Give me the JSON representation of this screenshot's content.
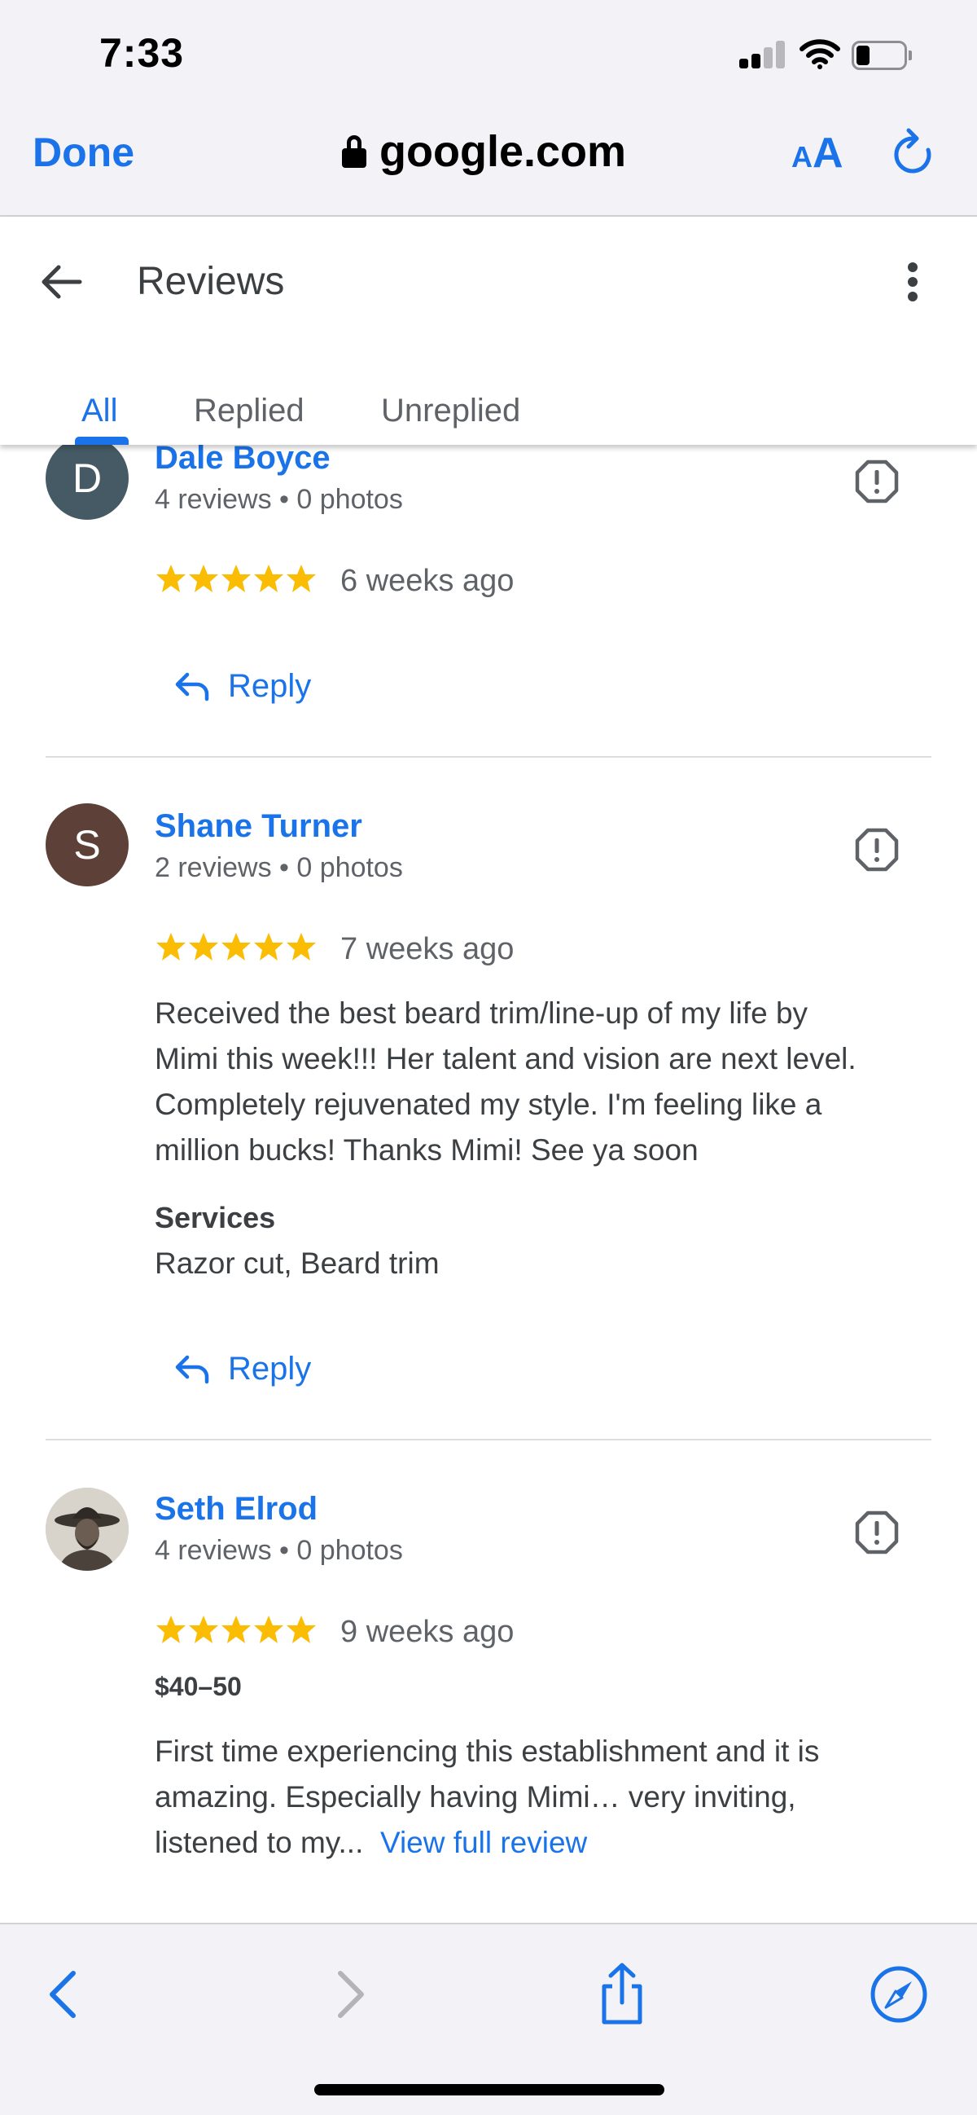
{
  "status_bar": {
    "time": "7:33"
  },
  "browser": {
    "done_label": "Done",
    "url": "google.com",
    "text_size_small": "A",
    "text_size_big": "A",
    "accent": "#1a73e8"
  },
  "header": {
    "title": "Reviews",
    "tabs": [
      {
        "label": "All",
        "active": true
      },
      {
        "label": "Replied",
        "active": false
      },
      {
        "label": "Unreplied",
        "active": false
      }
    ]
  },
  "reviews": [
    {
      "initial": "D",
      "avatar_color": "#455a64",
      "name": "Dale Boyce",
      "meta": "4 reviews • 0 photos",
      "rating": 5,
      "time_ago": "6 weeks ago",
      "reply_label": "Reply"
    },
    {
      "initial": "S",
      "avatar_color": "#5d4037",
      "name": "Shane Turner",
      "meta": "2 reviews • 0 photos",
      "rating": 5,
      "time_ago": "7 weeks ago",
      "text_lines": [
        "Received the best beard trim/line-up of my life by",
        "Mimi this week!!! Her talent and vision are next level.",
        "Completely rejuvenated my style. I'm feeling like a",
        "million bucks! Thanks Mimi! See ya soon"
      ],
      "services_label": "Services",
      "services_value": "Razor cut, Beard trim",
      "reply_label": "Reply"
    },
    {
      "name": "Seth Elrod",
      "meta": "4 reviews • 0 photos",
      "rating": 5,
      "time_ago": "9 weeks ago",
      "price": "$40–50",
      "text_lines": [
        "First time experiencing this establishment and it is",
        "amazing. Especially having Mimi… very inviting,",
        "listened to my..."
      ],
      "view_full_label": "View full review"
    }
  ],
  "colors": {
    "star": "#fbbc04",
    "link": "#1a73e8",
    "text": "#3c4043",
    "secondary_text": "#5f6368"
  },
  "toolbar": {
    "icons": [
      "back-icon",
      "forward-icon",
      "share-icon",
      "compass-icon"
    ]
  }
}
